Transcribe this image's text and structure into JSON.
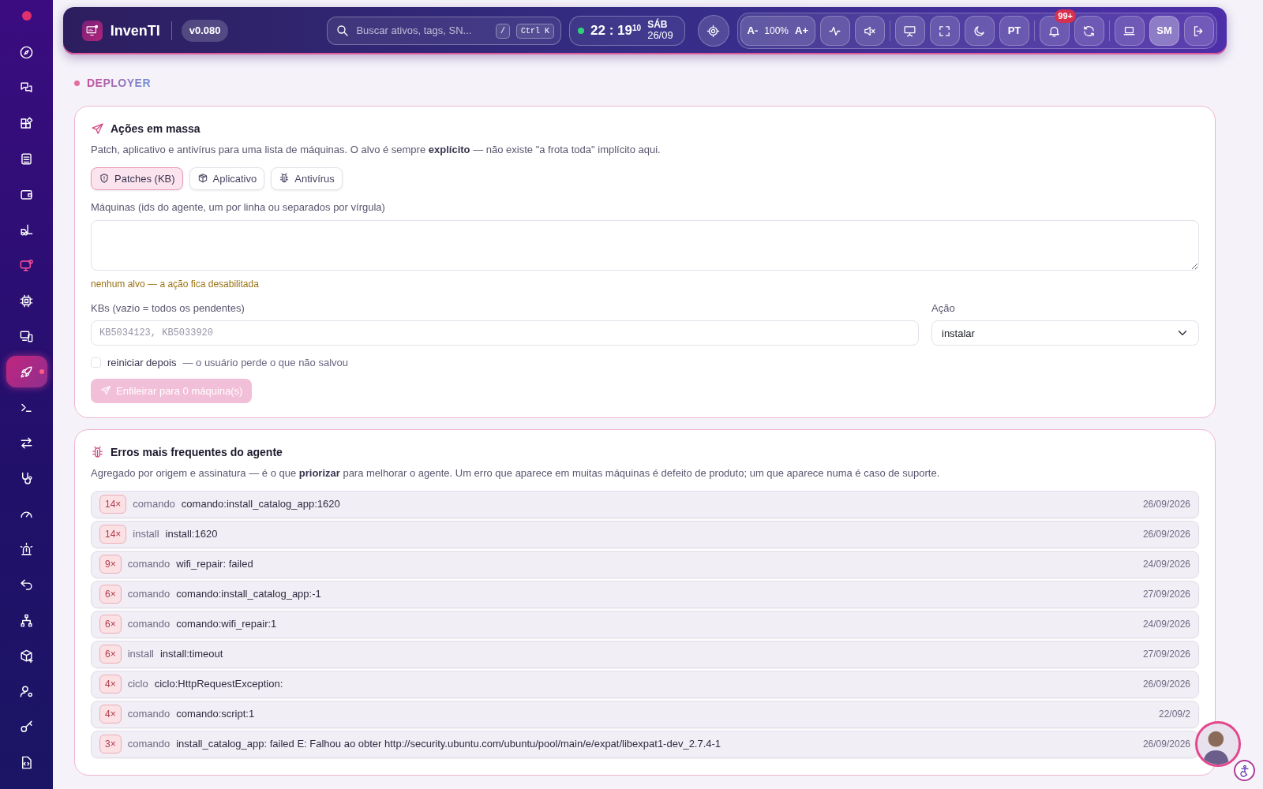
{
  "sidebar": {
    "items": [
      {
        "kind": "compass",
        "selected": false,
        "alert": false
      },
      {
        "kind": "chat",
        "selected": false,
        "alert": false
      },
      {
        "kind": "apps",
        "selected": false,
        "alert": false
      },
      {
        "kind": "archive",
        "selected": false,
        "alert": false
      },
      {
        "kind": "wallet",
        "selected": false,
        "alert": false
      },
      {
        "kind": "forklift",
        "selected": false,
        "alert": false
      },
      {
        "kind": "monitor",
        "selected": false,
        "alert": true
      },
      {
        "kind": "chip",
        "selected": false,
        "alert": false
      },
      {
        "kind": "devices",
        "selected": false,
        "alert": false
      },
      {
        "kind": "rocket",
        "selected": true,
        "alert": false
      },
      {
        "kind": "terminal",
        "selected": false,
        "alert": false
      },
      {
        "kind": "arrows",
        "selected": false,
        "alert": false
      },
      {
        "kind": "stethoscope",
        "selected": false,
        "alert": false
      },
      {
        "kind": "gauge",
        "selected": false,
        "alert": false
      },
      {
        "kind": "siren",
        "selected": false,
        "alert": false
      },
      {
        "kind": "undo",
        "selected": false,
        "alert": false
      },
      {
        "kind": "network",
        "selected": false,
        "alert": false
      },
      {
        "kind": "box",
        "selected": false,
        "alert": false
      },
      {
        "kind": "user-gear",
        "selected": false,
        "alert": false
      },
      {
        "kind": "key",
        "selected": false,
        "alert": false
      },
      {
        "kind": "code-file",
        "selected": false,
        "alert": false
      }
    ]
  },
  "topbar": {
    "app_name": "InvenTI",
    "version": "v0.080",
    "search": {
      "placeholder": "Buscar ativos, tags, SN...",
      "shortcuts": [
        "/",
        "Ctrl K"
      ]
    },
    "clock": {
      "online": true,
      "time": "22 : 19",
      "seconds": "10",
      "weekday": "SÁB",
      "date": "26/09"
    },
    "button_groups": [
      [
        {
          "kind": "font-decrease",
          "label": "A-",
          "selected": false
        },
        {
          "kind": "zoom",
          "label": "100%",
          "selected": false
        },
        {
          "kind": "font-increase",
          "label": "A+",
          "selected": false
        },
        {
          "kind": "pulse",
          "selected": false
        },
        {
          "kind": "mute",
          "selected": false
        }
      ],
      [
        {
          "kind": "presentation",
          "selected": false
        },
        {
          "kind": "fullscreen",
          "selected": false
        },
        {
          "kind": "moon",
          "selected": false
        },
        {
          "kind": "text",
          "label": "PT",
          "selected": false
        }
      ],
      [
        {
          "kind": "bell",
          "badge": "99+",
          "selected": false
        },
        {
          "kind": "refresh",
          "selected": false
        }
      ],
      [
        {
          "kind": "laptop",
          "selected": false
        },
        {
          "kind": "text",
          "label": "SM",
          "selected": true
        },
        {
          "kind": "logout",
          "selected": false
        }
      ]
    ]
  },
  "page": {
    "section": "DEPLOYER"
  },
  "bulk_actions": {
    "title": "Ações em massa",
    "description": "Patch, aplicativo e antivírus para uma lista de máquinas. O alvo é sempre **explícito** — não existe \"a frota toda\" implícito aqui.",
    "tabs": [
      {
        "kind": "shield",
        "label": "Patches (KB)",
        "selected": true
      },
      {
        "kind": "package",
        "label": "Aplicativo",
        "selected": false
      },
      {
        "kind": "bug",
        "label": "Antivírus",
        "selected": false
      }
    ],
    "machines_label": "Máquinas (ids do agente, um por linha ou separados por vírgula)",
    "warning": "nenhum alvo — a ação fica desabilitada",
    "kbs_label": "KBs (vazio = todos os pendentes)",
    "kbs_placeholder": "KB5034123, KB5033920",
    "action_label": "Ação",
    "action_value": "instalar",
    "restart": {
      "label": "reiniciar depois",
      "hint": "— o usuário perde o que não salvou",
      "checked": false
    },
    "submit": {
      "label": "Enfileirar para 0 máquina(s)",
      "disabled": true
    }
  },
  "agent_errors": {
    "title": "Erros mais frequentes do agente",
    "description": "Agregado por origem e assinatura — é o que **priorizar** para melhorar o agente. Um erro que aparece em muitas máquinas é defeito de produto; um que aparece numa é caso de suporte.",
    "rows": [
      {
        "count": "14×",
        "origin": "comando",
        "signature": "comando:install_catalog_app:1620",
        "date": "26/09/2026"
      },
      {
        "count": "14×",
        "origin": "install",
        "signature": "install:1620",
        "date": "26/09/2026"
      },
      {
        "count": "9×",
        "origin": "comando",
        "signature": "wifi_repair: failed",
        "date": "24/09/2026"
      },
      {
        "count": "6×",
        "origin": "comando",
        "signature": "comando:install_catalog_app:-1",
        "date": "27/09/2026"
      },
      {
        "count": "6×",
        "origin": "comando",
        "signature": "comando:wifi_repair:1",
        "date": "24/09/2026"
      },
      {
        "count": "6×",
        "origin": "install",
        "signature": "install:timeout",
        "date": "27/09/2026"
      },
      {
        "count": "4×",
        "origin": "ciclo",
        "signature": "ciclo:HttpRequestException:",
        "date": "26/09/2026"
      },
      {
        "count": "4×",
        "origin": "comando",
        "signature": "comando:script:1",
        "date": "22/09/2"
      },
      {
        "count": "3×",
        "origin": "comando",
        "signature": "install_catalog_app: failed E: Falhou ao obter http://security.ubuntu.com/ubuntu/pool/main/e/expat/libexpat1-dev_2.7.4-1",
        "date": "26/09/2026"
      }
    ]
  }
}
